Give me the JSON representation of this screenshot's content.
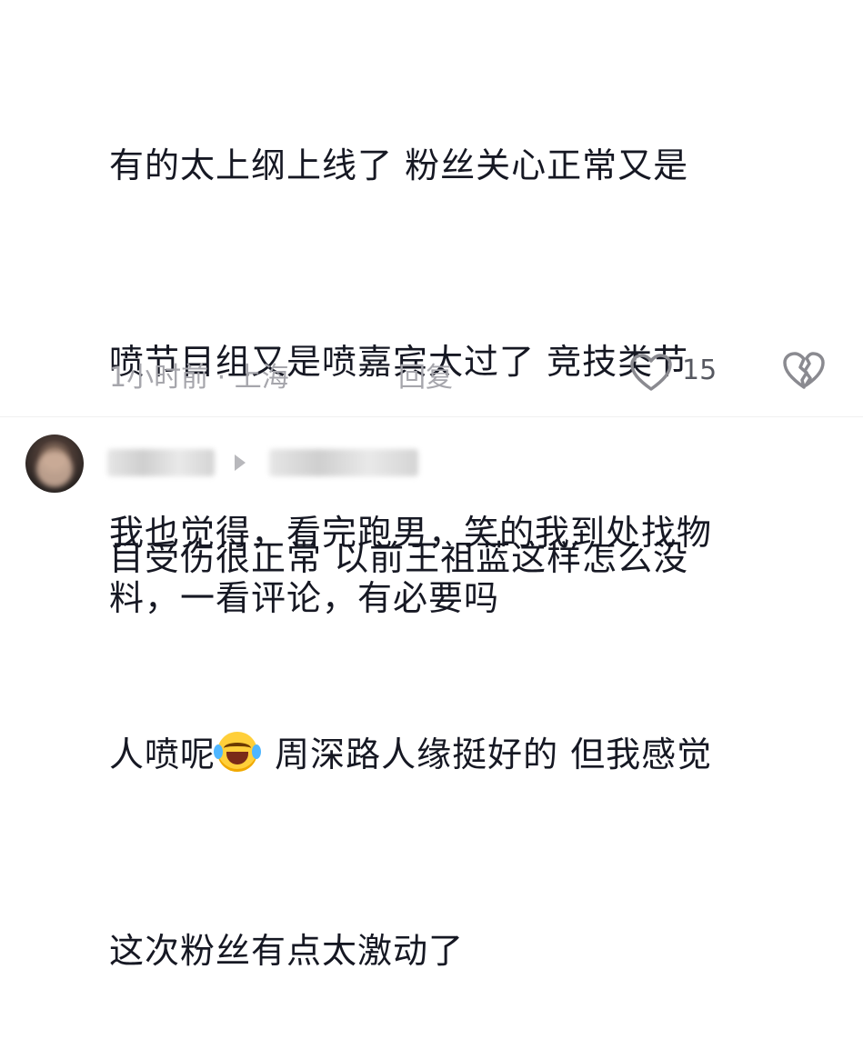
{
  "comment": {
    "lines": [
      "有的太上纲上线了 粉丝关心正常又是",
      "喷节目组又是喷嘉宾太过了 竞技类节",
      "目受伤很正常 以前王祖蓝这样怎么没",
      "人喷呢",
      " 周深路人缘挺好的 但我感觉",
      "这次粉丝有点太激动了"
    ],
    "emoji": "crying-laughing-emoji",
    "meta_time_location": "1小时前 · 上海",
    "reply_label": "回复",
    "like_count": "15"
  },
  "reply": {
    "lines": [
      "我也觉得，看完跑男，笑的我到处找物",
      "料，一看评论，有必要吗"
    ]
  },
  "colors": {
    "text": "#161823",
    "meta": "#a6a6ac"
  }
}
